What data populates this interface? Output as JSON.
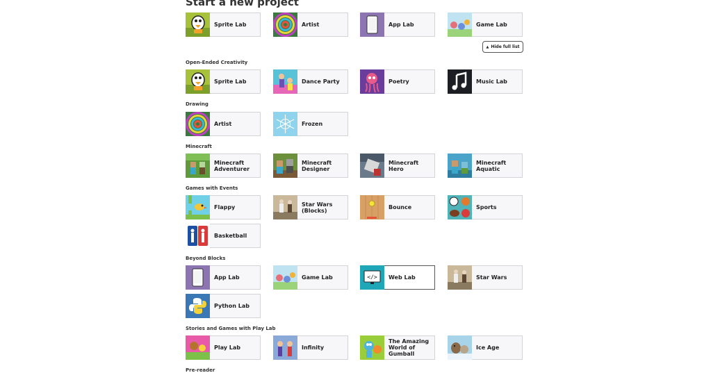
{
  "page": {
    "title": "Start a new project"
  },
  "toggle": {
    "hide_full_list": "Hide full list",
    "icon": "caret-up-icon"
  },
  "featured": [
    {
      "label": "Sprite Lab",
      "icon": "sprite-lab-thumbnail"
    },
    {
      "label": "Artist",
      "icon": "artist-thumbnail"
    },
    {
      "label": "App Lab",
      "icon": "app-lab-thumbnail"
    },
    {
      "label": "Game Lab",
      "icon": "game-lab-thumbnail"
    }
  ],
  "sections": [
    {
      "title": "Open-Ended Creativity",
      "items": [
        "Sprite Lab",
        "Dance Party",
        "Poetry",
        "Music Lab"
      ]
    },
    {
      "title": "Drawing",
      "items": [
        "Artist",
        "Frozen"
      ]
    },
    {
      "title": "Minecraft",
      "items": [
        "Minecraft Adventurer",
        "Minecraft Designer",
        "Minecraft Hero",
        "Minecraft Aquatic"
      ]
    },
    {
      "title": "Games with Events",
      "items": [
        "Flappy",
        "Star Wars (Blocks)",
        "Bounce",
        "Sports",
        "Basketball"
      ]
    },
    {
      "title": "Beyond Blocks",
      "items": [
        "App Lab",
        "Game Lab",
        "Web Lab",
        "Star Wars",
        "Python Lab"
      ]
    },
    {
      "title": "Stories and Games with Play Lab",
      "items": [
        "Play Lab",
        "Infinity",
        "The Amazing World of Gumball",
        "Ice Age"
      ]
    },
    {
      "title": "Pre-reader",
      "items": []
    }
  ],
  "selected": "Web Lab",
  "colors": {
    "tile_bg": "#f7f7f9",
    "tile_border": "#d4d4d8",
    "selected_border": "#555555"
  }
}
